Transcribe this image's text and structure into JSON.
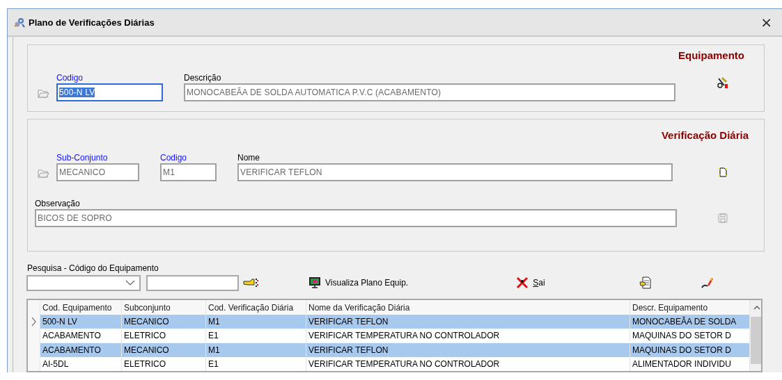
{
  "window": {
    "title": "Plano de Verificações Diárias",
    "close": "×"
  },
  "equipment_panel": {
    "title": "Equipamento",
    "fields": [
      {
        "label": "Codigo",
        "required": true,
        "value": "500-N LV",
        "focused": true,
        "disabled": false
      },
      {
        "label": "Descrição",
        "required": false,
        "value": "MONOCABEÃA DE SOLDA AUTOMATICA P.V.C (ACABAMENTO)",
        "focused": false,
        "disabled": true
      }
    ],
    "action": {
      "disabled": false
    }
  },
  "check_panel": {
    "title": "Verificação Diária",
    "fields": [
      {
        "label": "Sub-Conjunto",
        "required": true,
        "value": "MECANICO",
        "focused": false,
        "disabled": true
      },
      {
        "label": "Codigo",
        "required": true,
        "value": "M1",
        "focused": false,
        "disabled": true
      },
      {
        "label": "Nome",
        "required": false,
        "value": "VERIFICAR TEFLON",
        "focused": false,
        "disabled": true
      }
    ],
    "new_action": {
      "disabled": false
    },
    "observation": {
      "label": "Observação",
      "value": "BICOS DE SOPRO",
      "disabled": true
    },
    "save_action": {
      "disabled": true
    }
  },
  "search": {
    "label": "Pesquisa - Código do Equipamento",
    "buttons": [
      {
        "kind": "view",
        "label": "Visualiza Plano Equip.",
        "mnemonic": false
      },
      {
        "kind": "exit",
        "label": "Sai",
        "mnemonic": true
      },
      {
        "kind": "report"
      },
      {
        "kind": "clear"
      }
    ]
  },
  "table": {
    "columns": [
      "Cod. Equipamento",
      "Subconjunto",
      "Cod. Verificação Diária",
      "Nome da Verificação Diária",
      "Descr. Equipamento"
    ],
    "rows": [
      {
        "current": true,
        "selected": true,
        "cells": [
          "500-N LV",
          "MECANICO",
          "M1",
          "VERIFICAR TEFLON",
          "MONOCABEÃA DE SOLDA"
        ]
      },
      {
        "current": false,
        "selected": false,
        "cells": [
          "ACABAMENTO",
          "ELETRICO",
          "E1",
          "VERIFICAR TEMPERATURA NO CONTROLADOR",
          "MAQUINAS DO SETOR D"
        ]
      },
      {
        "current": false,
        "selected": true,
        "cells": [
          "ACABAMENTO",
          "MECANICO",
          "M1",
          "VERIFICAR TEFLON",
          "MAQUINAS DO SETOR D"
        ]
      },
      {
        "current": false,
        "selected": false,
        "cells": [
          "AI-5DL",
          "ELETRICO",
          "E1",
          "VERIFICAR TEMPERATURA NO CONTROLADOR",
          "ALIMENTADOR INDIVIDU"
        ]
      }
    ]
  }
}
